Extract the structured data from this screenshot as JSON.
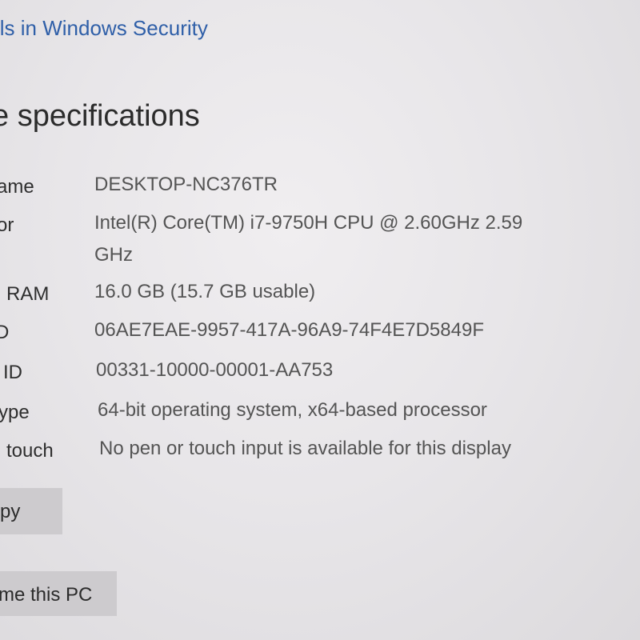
{
  "header": {
    "link_text": "ils in Windows Security",
    "section_title": "e specifications"
  },
  "specs": [
    {
      "label": "ame",
      "value": "DESKTOP-NC376TR"
    },
    {
      "label": "or",
      "value": "Intel(R) Core(TM) i7-9750H CPU @ 2.60GHz   2.59",
      "value_line2": "GHz"
    },
    {
      "label": "RAM",
      "value": "16.0 GB (15.7 GB usable)"
    },
    {
      "label": "D",
      "value": "06AE7EAE-9957-417A-96A9-74F4E7D5849F"
    },
    {
      "label": "ID",
      "value": "00331-10000-00001-AA753"
    },
    {
      "label": "ype",
      "value": "64-bit operating system, x64-based processor"
    },
    {
      "label": "touch",
      "value": "No pen or touch input is available for this display"
    }
  ],
  "buttons": {
    "copy_label": "py",
    "rename_label": "me this PC"
  },
  "colors": {
    "link": "#2f5fa8",
    "button_bg": "#cdcbce"
  }
}
